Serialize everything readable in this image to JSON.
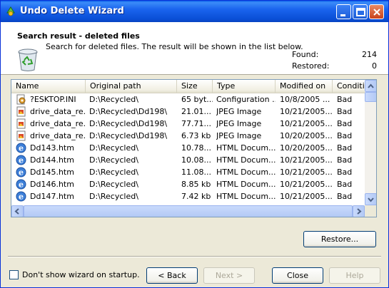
{
  "window": {
    "title": "Undo Delete Wizard",
    "colors": {
      "titlebar": "#0a54e6",
      "close_button": "#d4481f",
      "face": "#ece9d8"
    }
  },
  "header": {
    "title": "Search result - deleted files",
    "description": "Search for deleted files. The result will be shown in the list below.",
    "found_label": "Found:",
    "found_value": "214",
    "restored_label": "Restored:",
    "restored_value": "0"
  },
  "list": {
    "columns": [
      "Name",
      "Original path",
      "Size",
      "Type",
      "Modified on",
      "Conditio"
    ],
    "rows": [
      {
        "icon": "config-file-icon",
        "name": "?ESKTOP.INI",
        "path": "D:\\Recycled\\",
        "size": "65 byt...",
        "type": "Configuration ...",
        "modified": "10/8/2005 ...",
        "condition": "Bad"
      },
      {
        "icon": "jpeg-file-icon",
        "name": "drive_data_re...",
        "path": "D:\\Recycled\\Dd198\\",
        "size": "21.01...",
        "type": "JPEG Image",
        "modified": "10/21/2005...",
        "condition": "Bad"
      },
      {
        "icon": "jpeg-file-icon",
        "name": "drive_data_re...",
        "path": "D:\\Recycled\\Dd198\\",
        "size": "77.71...",
        "type": "JPEG Image",
        "modified": "10/21/2005...",
        "condition": "Bad"
      },
      {
        "icon": "jpeg-file-icon",
        "name": "drive_data_re...",
        "path": "D:\\Recycled\\Dd198\\",
        "size": "6.73 kb",
        "type": "JPEG Image",
        "modified": "10/20/2005...",
        "condition": "Bad"
      },
      {
        "icon": "html-file-icon",
        "name": "Dd143.htm",
        "path": "D:\\Recycled\\",
        "size": "10.78...",
        "type": "HTML Docum...",
        "modified": "10/20/2005...",
        "condition": "Bad"
      },
      {
        "icon": "html-file-icon",
        "name": "Dd144.htm",
        "path": "D:\\Recycled\\",
        "size": "10.08...",
        "type": "HTML Docum...",
        "modified": "10/21/2005...",
        "condition": "Bad"
      },
      {
        "icon": "html-file-icon",
        "name": "Dd145.htm",
        "path": "D:\\Recycled\\",
        "size": "11.08...",
        "type": "HTML Docum...",
        "modified": "10/21/2005...",
        "condition": "Bad"
      },
      {
        "icon": "html-file-icon",
        "name": "Dd146.htm",
        "path": "D:\\Recycled\\",
        "size": "8.85 kb",
        "type": "HTML Docum...",
        "modified": "10/21/2005...",
        "condition": "Bad"
      },
      {
        "icon": "html-file-icon",
        "name": "Dd147.htm",
        "path": "D:\\Recycled\\",
        "size": "7.42 kb",
        "type": "HTML Docum...",
        "modified": "10/21/2005...",
        "condition": "Bad"
      }
    ]
  },
  "buttons": {
    "restore": "Restore...",
    "back": "< Back",
    "next": "Next >",
    "close": "Close",
    "help": "Help"
  },
  "footer": {
    "dont_show_label": "Don't show wizard on startup.",
    "dont_show_checked": false
  }
}
